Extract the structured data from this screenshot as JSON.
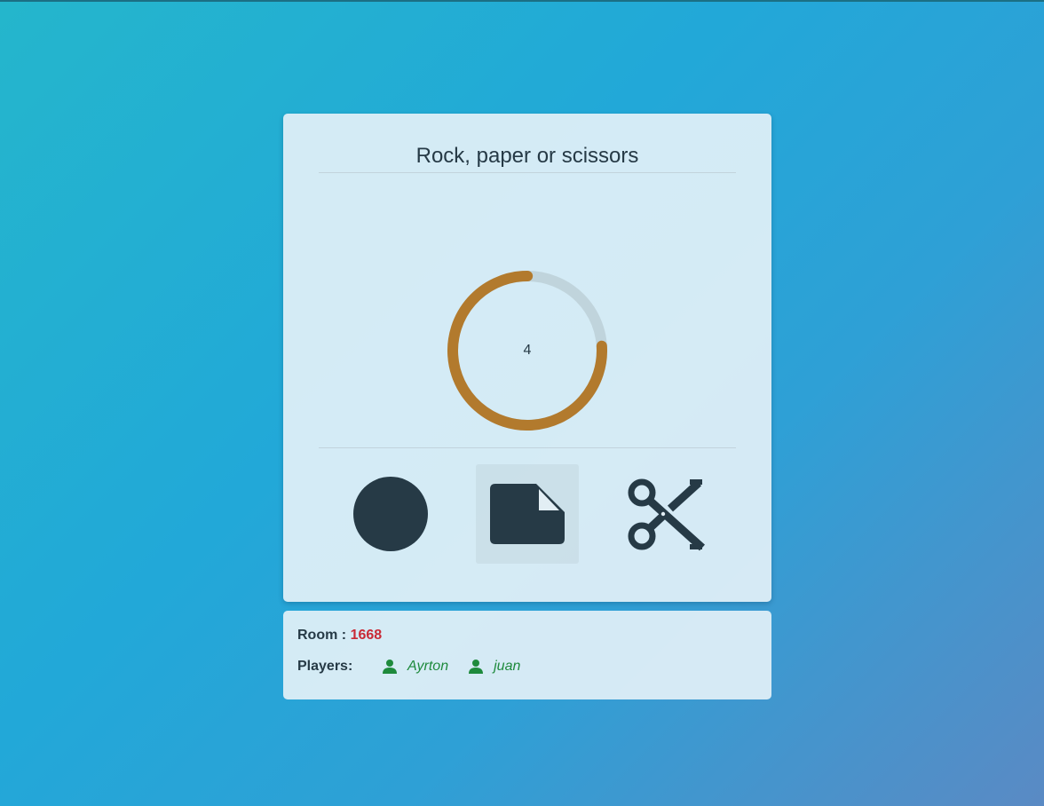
{
  "game": {
    "title": "Rock, paper or scissors",
    "timer": {
      "count": "4",
      "progress": 0.76,
      "color": "#b27a2d",
      "track_color": "#c0d4dc"
    },
    "choices": [
      {
        "name": "rock",
        "icon": "circle-icon",
        "selected": false
      },
      {
        "name": "paper",
        "icon": "paper-icon",
        "selected": true
      },
      {
        "name": "scissors",
        "icon": "scissors-icon",
        "selected": false
      }
    ]
  },
  "room": {
    "label": "Room :",
    "value": "1668",
    "value_color": "#c92a36"
  },
  "players": {
    "label": "Players:",
    "items": [
      {
        "name": "Ayrton",
        "icon": "person-icon"
      },
      {
        "name": "juan",
        "icon": "person-icon"
      }
    ],
    "color": "#1e8a3c"
  }
}
